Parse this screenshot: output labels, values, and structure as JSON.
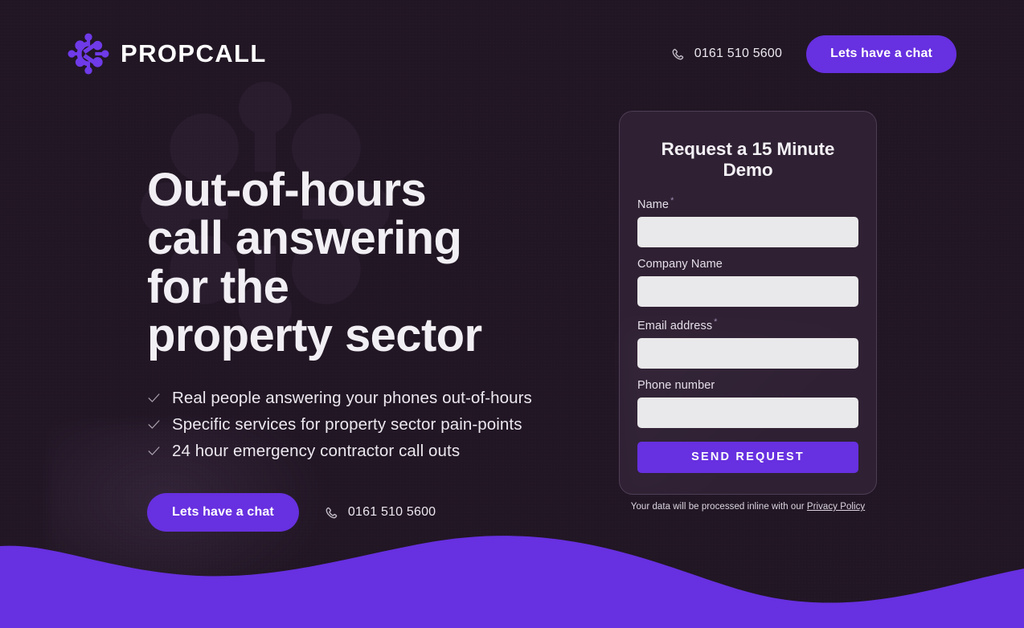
{
  "brand": {
    "name": "PROPCALL",
    "logo_icon": "network-nodes-icon",
    "accent_color": "#6730e0"
  },
  "header": {
    "phone_icon": "phone-icon",
    "phone": "0161 510 5600",
    "cta_label": "Lets have a chat"
  },
  "hero": {
    "headline": "Out-of-hours call answering for the property sector",
    "bullet_icon": "check-icon",
    "bullets": [
      "Real people answering your phones out-of-hours",
      "Specific services for property sector pain-points",
      "24 hour emergency contractor call outs"
    ],
    "cta_label": "Lets have a chat",
    "phone_icon": "phone-icon",
    "phone": "0161 510 5600"
  },
  "form": {
    "title": "Request a 15 Minute Demo",
    "required_marker": "*",
    "fields": [
      {
        "label": "Name",
        "required": true,
        "value": "",
        "placeholder": ""
      },
      {
        "label": "Company Name",
        "required": false,
        "value": "",
        "placeholder": ""
      },
      {
        "label": "Email address",
        "required": true,
        "value": "",
        "placeholder": ""
      },
      {
        "label": "Phone number",
        "required": false,
        "value": "",
        "placeholder": ""
      }
    ],
    "submit_label": "SEND REQUEST"
  },
  "privacy": {
    "text": "Your data will be processed inline with our ",
    "link_label": "Privacy Policy"
  },
  "colors": {
    "page_background": "#211624",
    "accent_purple": "#6730e0",
    "card_background": "#38293e",
    "input_background": "#e9e8ea",
    "text_light": "#f2eff4"
  }
}
